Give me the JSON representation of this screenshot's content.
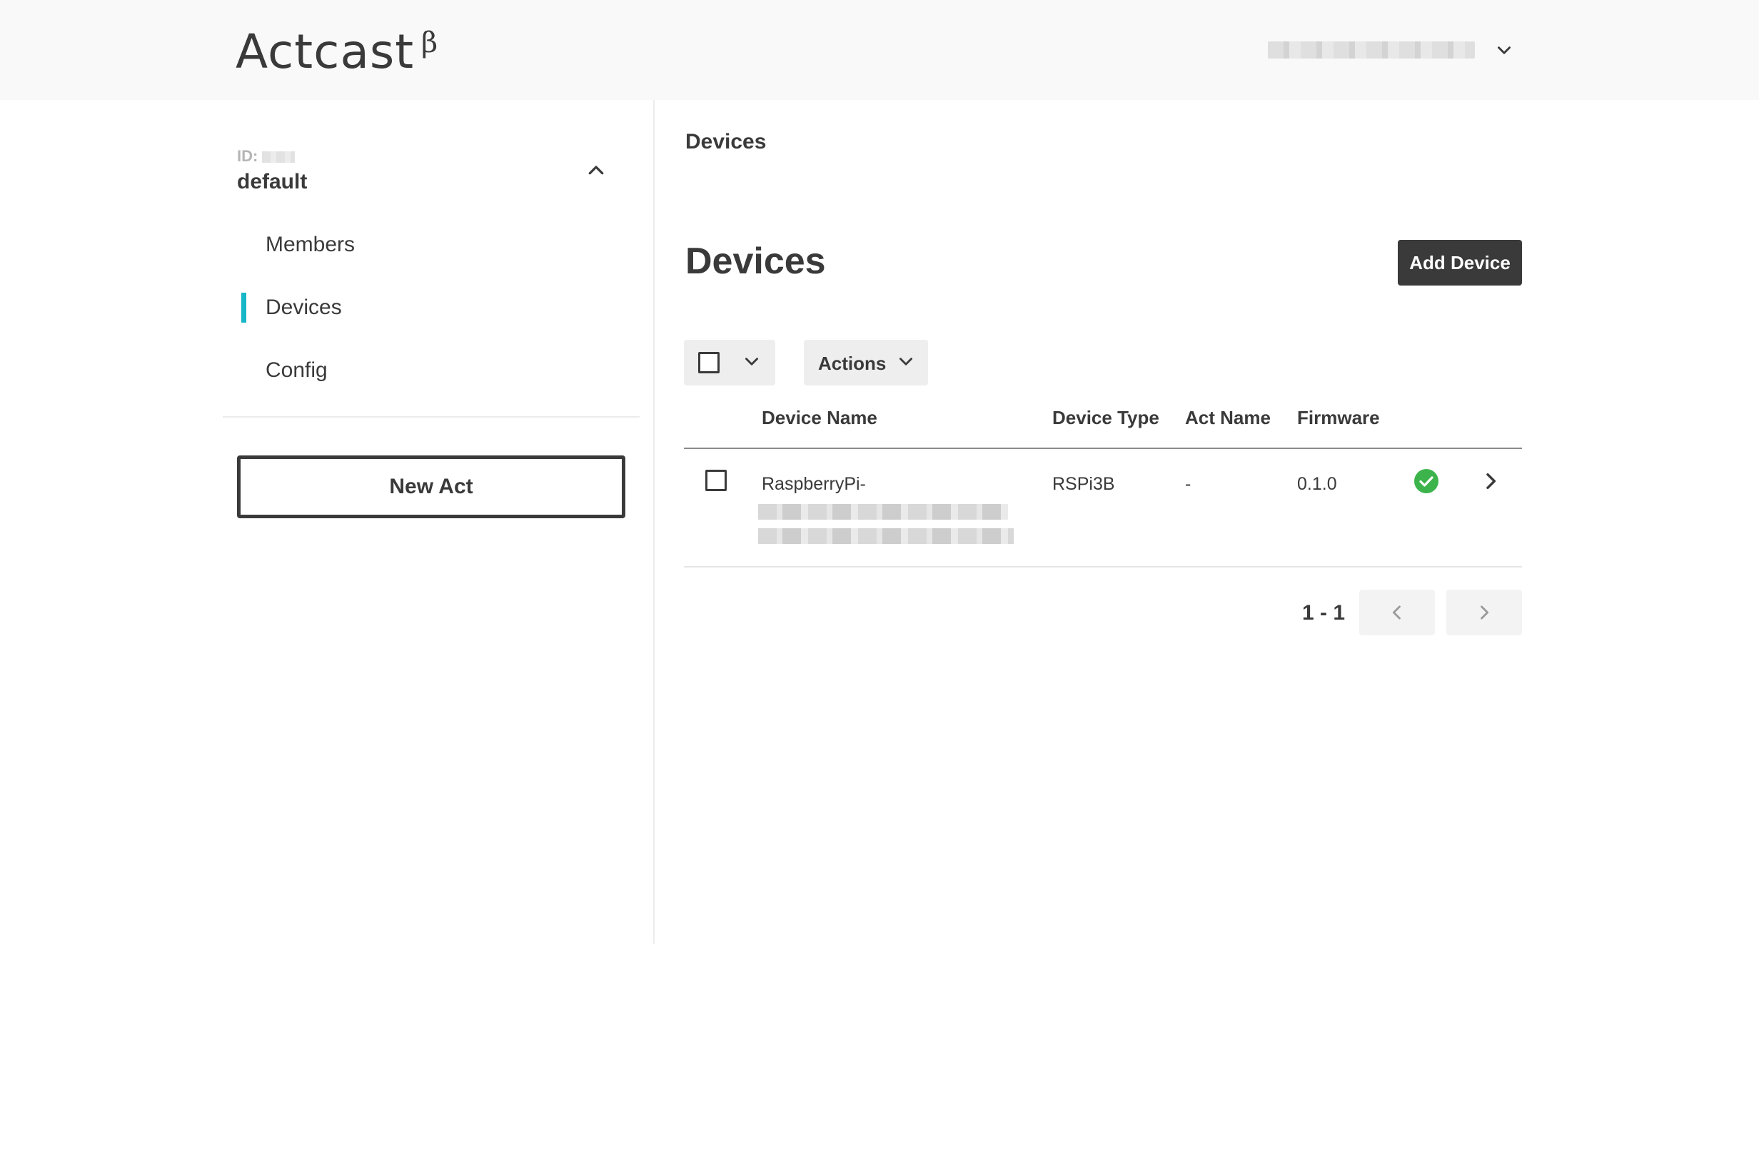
{
  "app": {
    "logo_text": "Actcast",
    "logo_superscript": "β",
    "user_menu_label": ""
  },
  "sidebar": {
    "group_id_label": "ID:",
    "group_name": "default",
    "items": [
      {
        "label": "Members",
        "active": false
      },
      {
        "label": "Devices",
        "active": true
      },
      {
        "label": "Config",
        "active": false
      }
    ],
    "new_act_label": "New Act",
    "active_color": "#17b6c8"
  },
  "main": {
    "breadcrumb": "Devices",
    "title": "Devices",
    "add_device_label": "Add Device",
    "actions_label": "Actions",
    "table": {
      "columns": [
        "Device Name",
        "Device Type",
        "Act Name",
        "Firmware"
      ],
      "rows": [
        {
          "device_name": "RaspberryPi-",
          "device_type": "RSPi3B",
          "act_name": "-",
          "firmware": "0.1.0",
          "status": "ok"
        }
      ]
    },
    "pagination": {
      "range": "1 - 1"
    }
  },
  "colors": {
    "status_ok": "#3cb44b",
    "primary_dark": "#3a3a3a",
    "accent": "#17b6c8"
  },
  "icons": {
    "user_menu": "chevron-down-icon",
    "group_toggle": "chevron-up-icon",
    "status": "check-circle-icon",
    "row_open": "chevron-right-icon",
    "prev": "chevron-left-icon",
    "next": "chevron-right-icon"
  }
}
